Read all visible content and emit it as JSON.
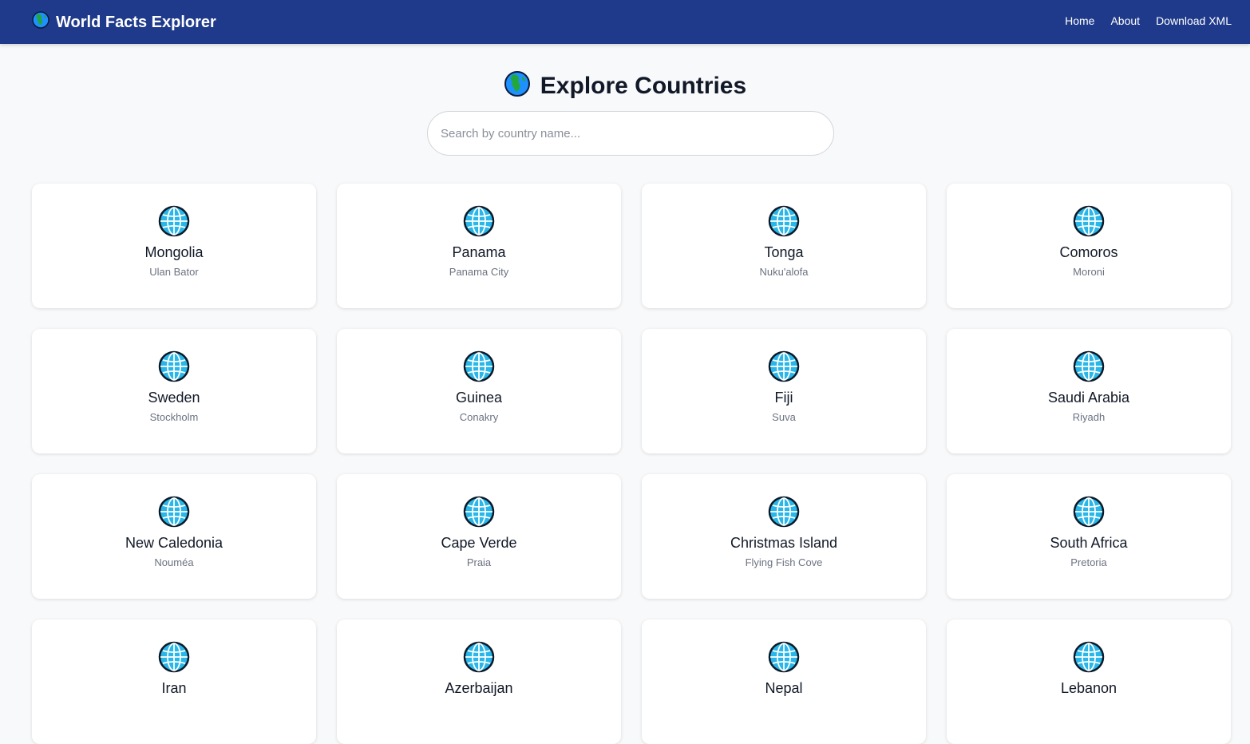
{
  "header": {
    "brand_icon": "earth-africa-icon",
    "brand_title": "World Facts Explorer",
    "nav": [
      {
        "label": "Home"
      },
      {
        "label": "About"
      },
      {
        "label": "Download XML"
      }
    ],
    "color": "#1f3a8a"
  },
  "main": {
    "title_icon": "earth-africa-icon",
    "title": "Explore Countries",
    "search": {
      "placeholder": "Search by country name...",
      "value": ""
    }
  },
  "cards": [
    {
      "icon": "globe-meridians-icon",
      "name": "Mongolia",
      "capital": "Ulan Bator"
    },
    {
      "icon": "globe-meridians-icon",
      "name": "Panama",
      "capital": "Panama City"
    },
    {
      "icon": "globe-meridians-icon",
      "name": "Tonga",
      "capital": "Nuku'alofa"
    },
    {
      "icon": "globe-meridians-icon",
      "name": "Comoros",
      "capital": "Moroni"
    },
    {
      "icon": "globe-meridians-icon",
      "name": "Sweden",
      "capital": "Stockholm"
    },
    {
      "icon": "globe-meridians-icon",
      "name": "Guinea",
      "capital": "Conakry"
    },
    {
      "icon": "globe-meridians-icon",
      "name": "Fiji",
      "capital": "Suva"
    },
    {
      "icon": "globe-meridians-icon",
      "name": "Saudi Arabia",
      "capital": "Riyadh"
    },
    {
      "icon": "globe-meridians-icon",
      "name": "New Caledonia",
      "capital": "Nouméa"
    },
    {
      "icon": "globe-meridians-icon",
      "name": "Cape Verde",
      "capital": "Praia"
    },
    {
      "icon": "globe-meridians-icon",
      "name": "Christmas Island",
      "capital": "Flying Fish Cove"
    },
    {
      "icon": "globe-meridians-icon",
      "name": "South Africa",
      "capital": "Pretoria"
    },
    {
      "icon": "globe-meridians-icon",
      "name": "Iran",
      "capital": ""
    },
    {
      "icon": "globe-meridians-icon",
      "name": "Azerbaijan",
      "capital": ""
    },
    {
      "icon": "globe-meridians-icon",
      "name": "Nepal",
      "capital": ""
    },
    {
      "icon": "globe-meridians-icon",
      "name": "Lebanon",
      "capital": ""
    }
  ]
}
